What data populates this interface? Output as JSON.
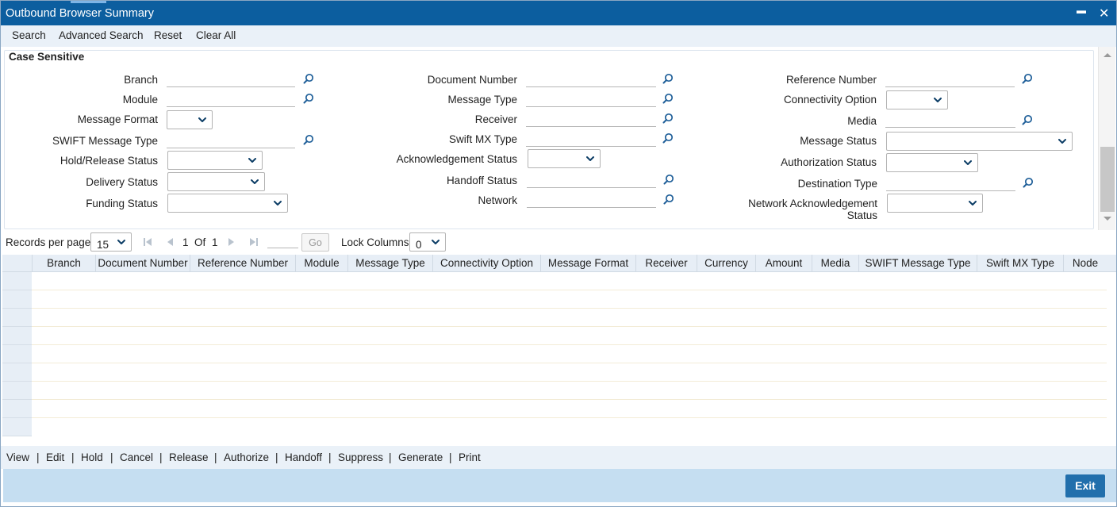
{
  "window": {
    "title": "Outbound Browser Summary",
    "minimize_glyph": "▬",
    "close_glyph": "✕"
  },
  "toolbar": {
    "search": "Search",
    "advanced_search": "Advanced Search",
    "reset": "Reset",
    "clear_all": "Clear All"
  },
  "form": {
    "legend": "Case Sensitive",
    "branch": "Branch",
    "module": "Module",
    "message_format": "Message Format",
    "swift_message_type": "SWIFT Message Type",
    "hold_release_status": "Hold/Release Status",
    "delivery_status": "Delivery Status",
    "funding_status": "Funding Status",
    "document_number": "Document Number",
    "message_type": "Message Type",
    "receiver": "Receiver",
    "swift_mx_type": "Swift MX Type",
    "acknowledgement_status": "Acknowledgement Status",
    "handoff_status": "Handoff Status",
    "network": "Network",
    "reference_number": "Reference Number",
    "connectivity_option": "Connectivity Option",
    "media": "Media",
    "message_status": "Message Status",
    "authorization_status": "Authorization Status",
    "destination_type": "Destination Type",
    "network_ack_status_line1": "Network Acknowledgement",
    "network_ack_status_line2": "Status"
  },
  "pager": {
    "records_per_page_label": "Records per page",
    "records_per_page_value": "15",
    "current_page": "1",
    "of_label": "Of",
    "total_pages": "1",
    "go_label": "Go",
    "lock_columns_label": "Lock Columns",
    "lock_columns_value": "0"
  },
  "grid": {
    "columns": [
      "Branch",
      "Document Number",
      "Reference Number",
      "Module",
      "Message Type",
      "Connectivity Option",
      "Message Format",
      "Receiver",
      "Currency",
      "Amount",
      "Media",
      "SWIFT Message Type",
      "Swift MX Type",
      "Node"
    ]
  },
  "actions": [
    "View",
    "Edit",
    "Hold",
    "Cancel",
    "Release",
    "Authorize",
    "Handoff",
    "Suppress",
    "Generate",
    "Print"
  ],
  "footer": {
    "exit": "Exit"
  },
  "colors": {
    "titlebar": "#0c5e9f",
    "toolbar": "#eaf1f8",
    "footer": "#c5def1",
    "exit_button": "#216fac",
    "icon": "#1f5f99"
  }
}
